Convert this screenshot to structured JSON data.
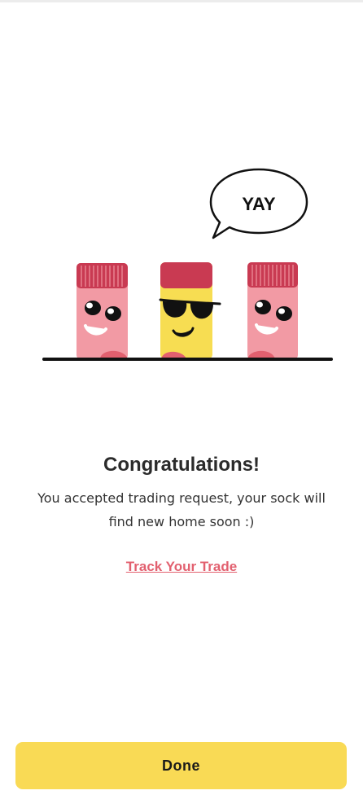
{
  "illustration": {
    "speech_bubble_text": "YAY",
    "colors": {
      "sock_pink": "#f29aa4",
      "sock_cuff": "#c93a52",
      "sock_yellow": "#f7dd52",
      "sock_heel": "#e2606f",
      "outline": "#111111"
    }
  },
  "content": {
    "title": "Congratulations!",
    "message_line1": "You accepted trading request, your sock will",
    "message_line2": "find new home soon :)",
    "track_link": "Track Your Trade"
  },
  "footer": {
    "done_label": "Done",
    "accent": "#f9da55"
  }
}
